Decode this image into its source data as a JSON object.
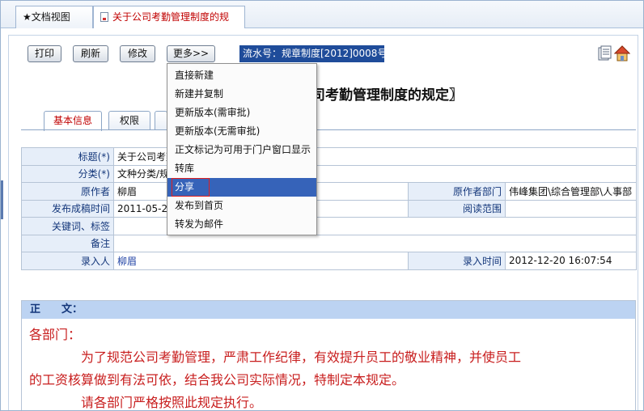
{
  "window_tabs": [
    {
      "label": "★文档视图"
    },
    {
      "label": "关于公司考勤管理制度的规"
    }
  ],
  "toolbar": {
    "print": "打印",
    "refresh": "刷新",
    "edit": "修改",
    "more": "更多>>",
    "serial": "流水号：规章制度[2012]0008号"
  },
  "doc_title": "司考勤管理制度的规定〗",
  "info_tabs": [
    {
      "label": "基本信息"
    },
    {
      "label": "权限"
    }
  ],
  "info": {
    "title_label": "标题(*)",
    "title_value": "关于公司考勤",
    "category_label": "分类(*)",
    "category_value": "文种分类/规",
    "author_label": "原作者",
    "author_value": "柳眉",
    "author_dept_label": "原作者部门",
    "author_dept_value": "伟峰集团\\综合管理部\\人事部",
    "published_label": "发布成稿时间",
    "published_value": "2011-05-20",
    "read_scope_label": "阅读范围",
    "read_scope_value": "",
    "keywords_label": "关键词、标签",
    "keywords_value": "",
    "remark_label": "备注",
    "remark_value": "",
    "entered_by_label": "录入人",
    "entered_by_value": "柳眉",
    "entered_time_label": "录入时间",
    "entered_time_value": "2012-12-20 16:07:54"
  },
  "body": {
    "heading": "正　　文：",
    "lines": [
      "各部门：",
      "为了规范公司考勤管理，严肃工作纪律，有效提升员工的敬业精神，并使员工",
      "的工资核算做到有法可依，结合我公司实际情况，特制定本规定。",
      "请各部门严格按照此规定执行。"
    ]
  },
  "more_menu": {
    "items": [
      "直接新建",
      "新建并复制",
      "更新版本(需审批)",
      "更新版本(无需审批)",
      "正文标记为可用于门户窗口显示",
      "转库",
      "分享",
      "发布到首页",
      "转发为邮件"
    ],
    "highlighted_index": 6
  },
  "colors": {
    "accent_blue": "#1f4c9a",
    "menu_highlight": "#3663b9",
    "label_bg": "#e6eef9",
    "body_text_red": "#c81e1e"
  },
  "icons": [
    "document-icon",
    "page-view-icon",
    "home-icon"
  ]
}
